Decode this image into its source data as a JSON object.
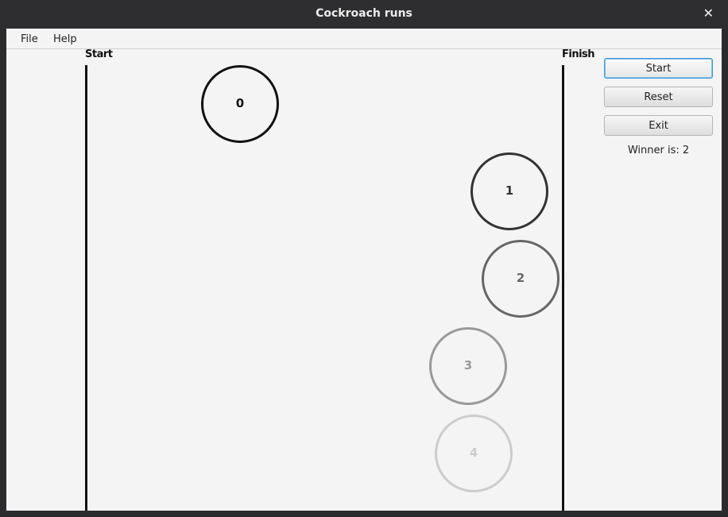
{
  "window": {
    "title": "Cockroach runs",
    "close_glyph": "✕"
  },
  "menu": {
    "items": [
      {
        "label": "File"
      },
      {
        "label": "Help"
      }
    ]
  },
  "track": {
    "start_label": "Start",
    "finish_label": "Finish"
  },
  "cockroaches": [
    {
      "label": "0",
      "color": "#111111"
    },
    {
      "label": "1",
      "color": "#333333"
    },
    {
      "label": "2",
      "color": "#666666"
    },
    {
      "label": "3",
      "color": "#999999"
    },
    {
      "label": "4",
      "color": "#cccccc"
    }
  ],
  "controls": {
    "start_label": "Start",
    "reset_label": "Reset",
    "exit_label": "Exit",
    "winner_text": "Winner is: 2"
  }
}
